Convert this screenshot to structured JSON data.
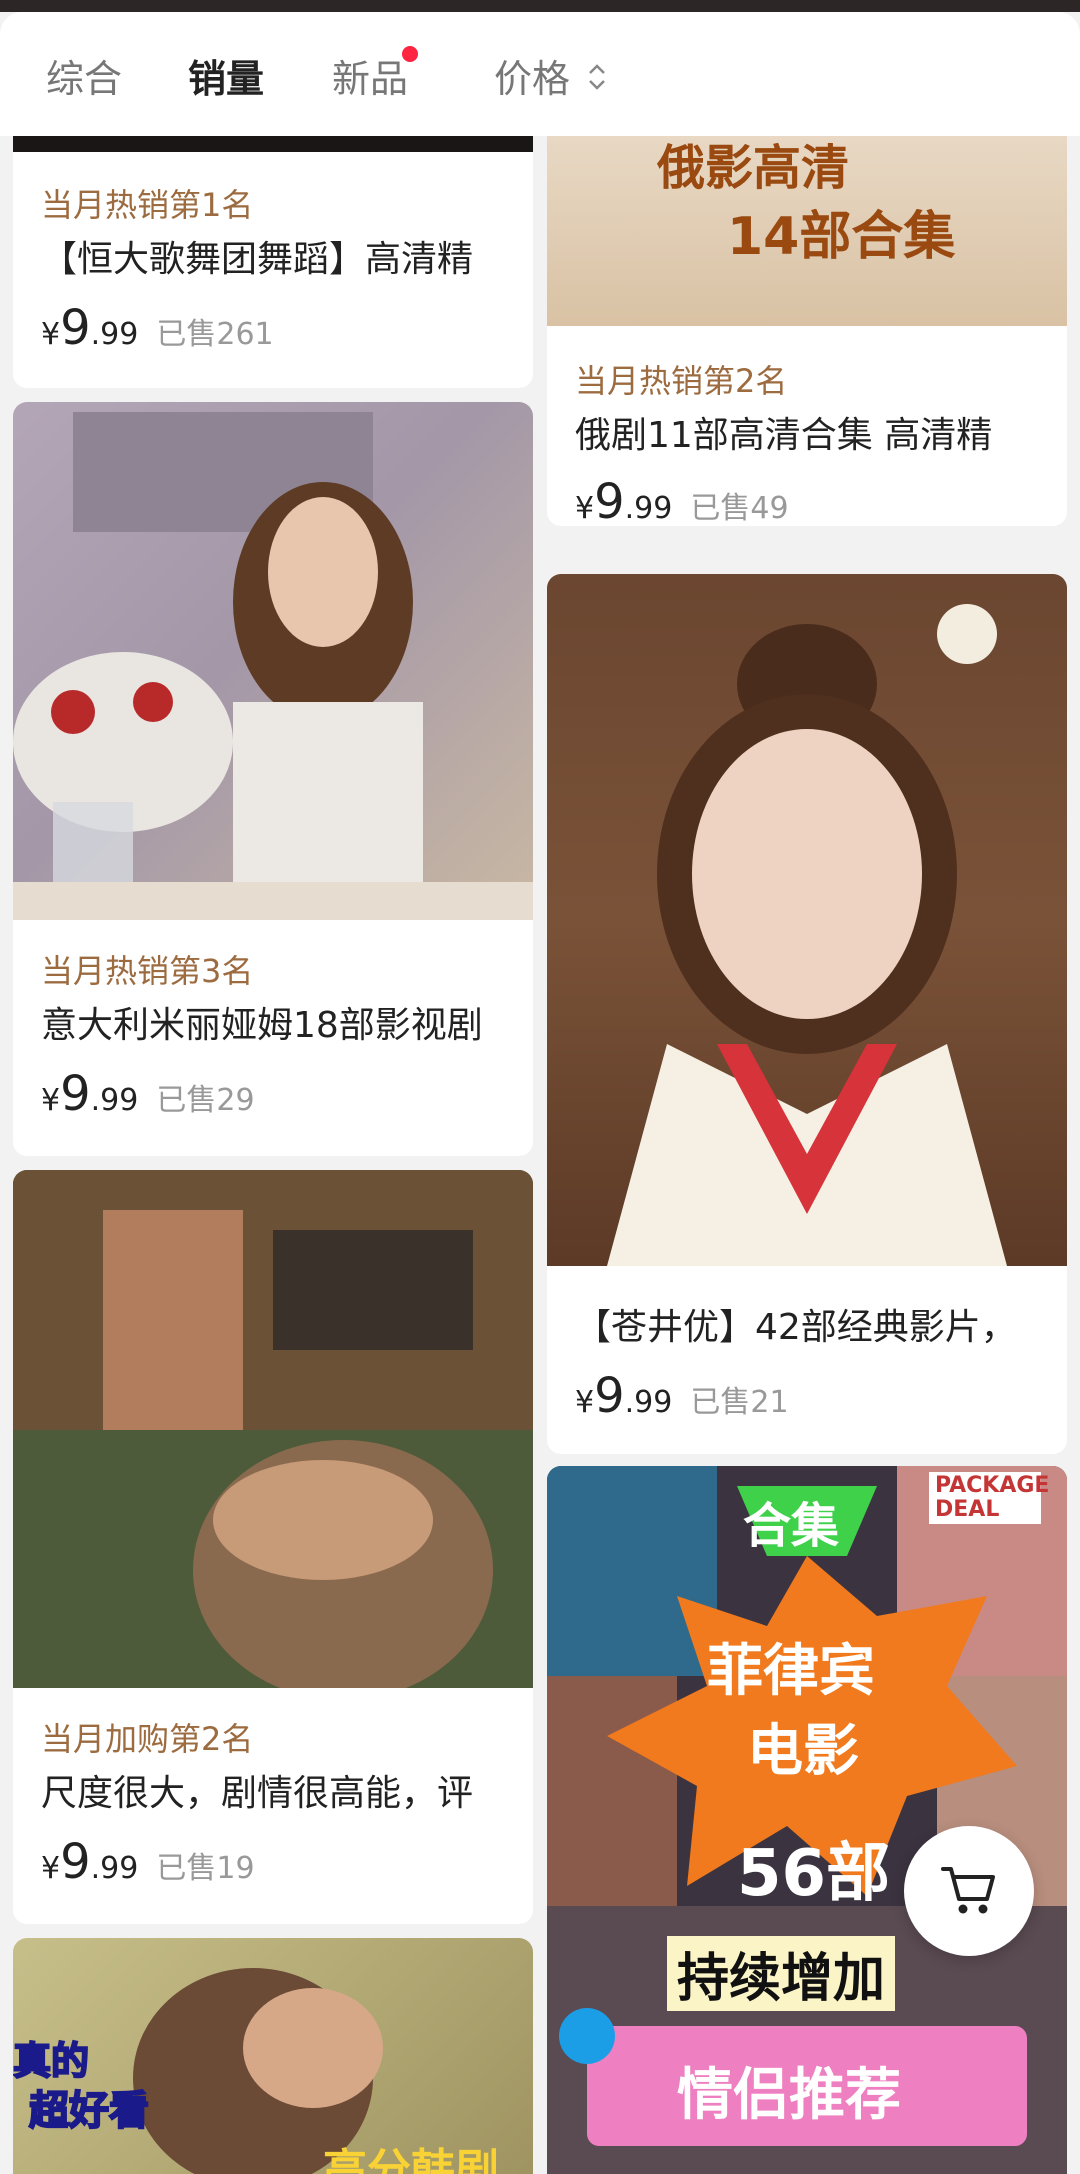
{
  "tabs": [
    {
      "label": "综合"
    },
    {
      "label": "销量"
    },
    {
      "label": "新品"
    },
    {
      "label": "价格"
    }
  ],
  "colors": {
    "accent_dot": "#ff2442",
    "rank_text": "#9c6b3f",
    "price": "#222222",
    "sold": "#999999"
  },
  "products": [
    {
      "rank": "当月热销第1名",
      "title": "【恒大歌舞团舞蹈】高清精",
      "price_yen": "¥",
      "price_int": "9",
      "price_dec": ".99",
      "sold": "已售261"
    },
    {
      "image_text_1": "俄影高清",
      "image_text_2": "14部合集",
      "rank": "当月热销第2名",
      "title": "俄剧11部高清合集  高清精",
      "price_yen": "¥",
      "price_int": "9",
      "price_dec": ".99",
      "sold": "已售49"
    },
    {
      "rank": "当月热销第3名",
      "title": "意大利米丽娅姆18部影视剧",
      "price_yen": "¥",
      "price_int": "9",
      "price_dec": ".99",
      "sold": "已售29"
    },
    {
      "title": "【苍井优】42部经典影片，",
      "price_yen": "¥",
      "price_int": "9",
      "price_dec": ".99",
      "sold": "已售21"
    },
    {
      "rank": "当月加购第2名",
      "title": "尺度很大，剧情很高能，评",
      "price_yen": "¥",
      "price_int": "9",
      "price_dec": ".99",
      "sold": "已售19"
    },
    {
      "image_text_1": "合集",
      "image_text_2": "菲律宾",
      "image_text_3": "电影",
      "image_text_4": "56部",
      "image_text_5": "持续增加",
      "image_text_6": "情侣推荐",
      "image_text_7": "PACKAGE DEAL"
    },
    {
      "image_text_1": "真的",
      "image_text_2": "超好看",
      "image_text_3": "高分韩剧"
    }
  ],
  "icons": {
    "sort": "sort-updown-icon",
    "cart": "cart-icon"
  }
}
